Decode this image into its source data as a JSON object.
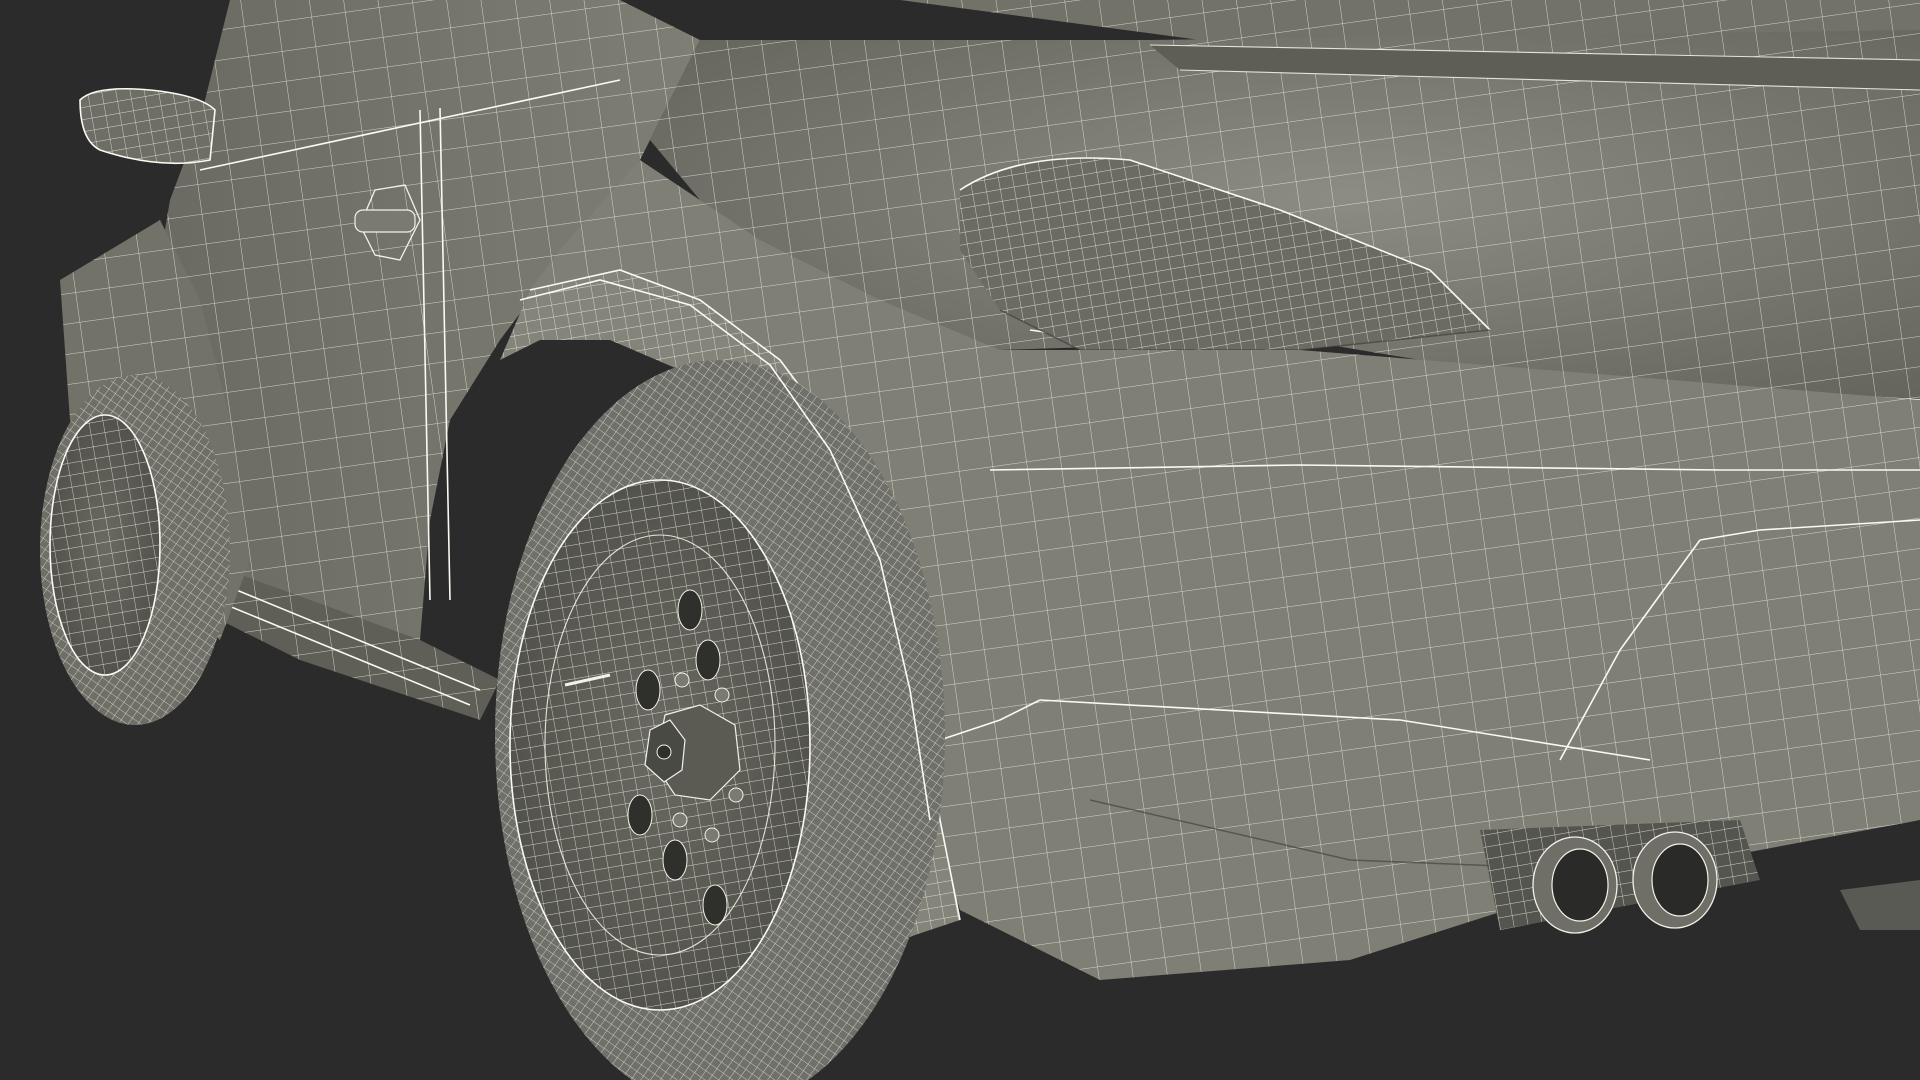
{
  "scene": {
    "colors": {
      "background": "#2b2b2b",
      "body_surface": "#7d7d73",
      "body_shadow": "#5d5d55",
      "body_highlight": "#9a9a8f",
      "wireframe": "#f2f2e8",
      "tire": "#6f6f67",
      "rim": "#5a5a53",
      "dark_detail": "#3c3c38"
    },
    "parts": {
      "mirror": "side-mirror",
      "door_handle": "door-handle",
      "rear_wheel": "rear-wheel",
      "front_wheel": "front-wheel",
      "rear_bumper": "rear-bumper",
      "exhaust": "twin-exhaust-pipes",
      "tail_light": "tail-light",
      "fender": "rear-fender-arch",
      "side_skirt": "side-skirt"
    }
  }
}
